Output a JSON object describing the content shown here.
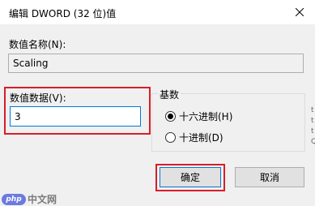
{
  "window": {
    "title": "编辑 DWORD (32 位)值",
    "close_icon": "close-icon"
  },
  "name_field": {
    "label": "数值名称(N):",
    "value": "Scaling"
  },
  "data_field": {
    "label": "数值数据(V):",
    "value": "3"
  },
  "base_group": {
    "title": "基数",
    "options": [
      {
        "label": "十六进制(H)",
        "checked": true
      },
      {
        "label": "十进制(D)",
        "checked": false
      }
    ]
  },
  "buttons": {
    "ok_label": "确定",
    "cancel_label": "取消"
  },
  "watermark": {
    "logo_text": "php",
    "text": "中文网"
  },
  "edge_text": [
    "t",
    "t",
    "t",
    "Q"
  ],
  "colors": {
    "highlight": "#d81e28",
    "focus_border": "#0078d7",
    "dialog_bg": "#f0f0f0"
  }
}
